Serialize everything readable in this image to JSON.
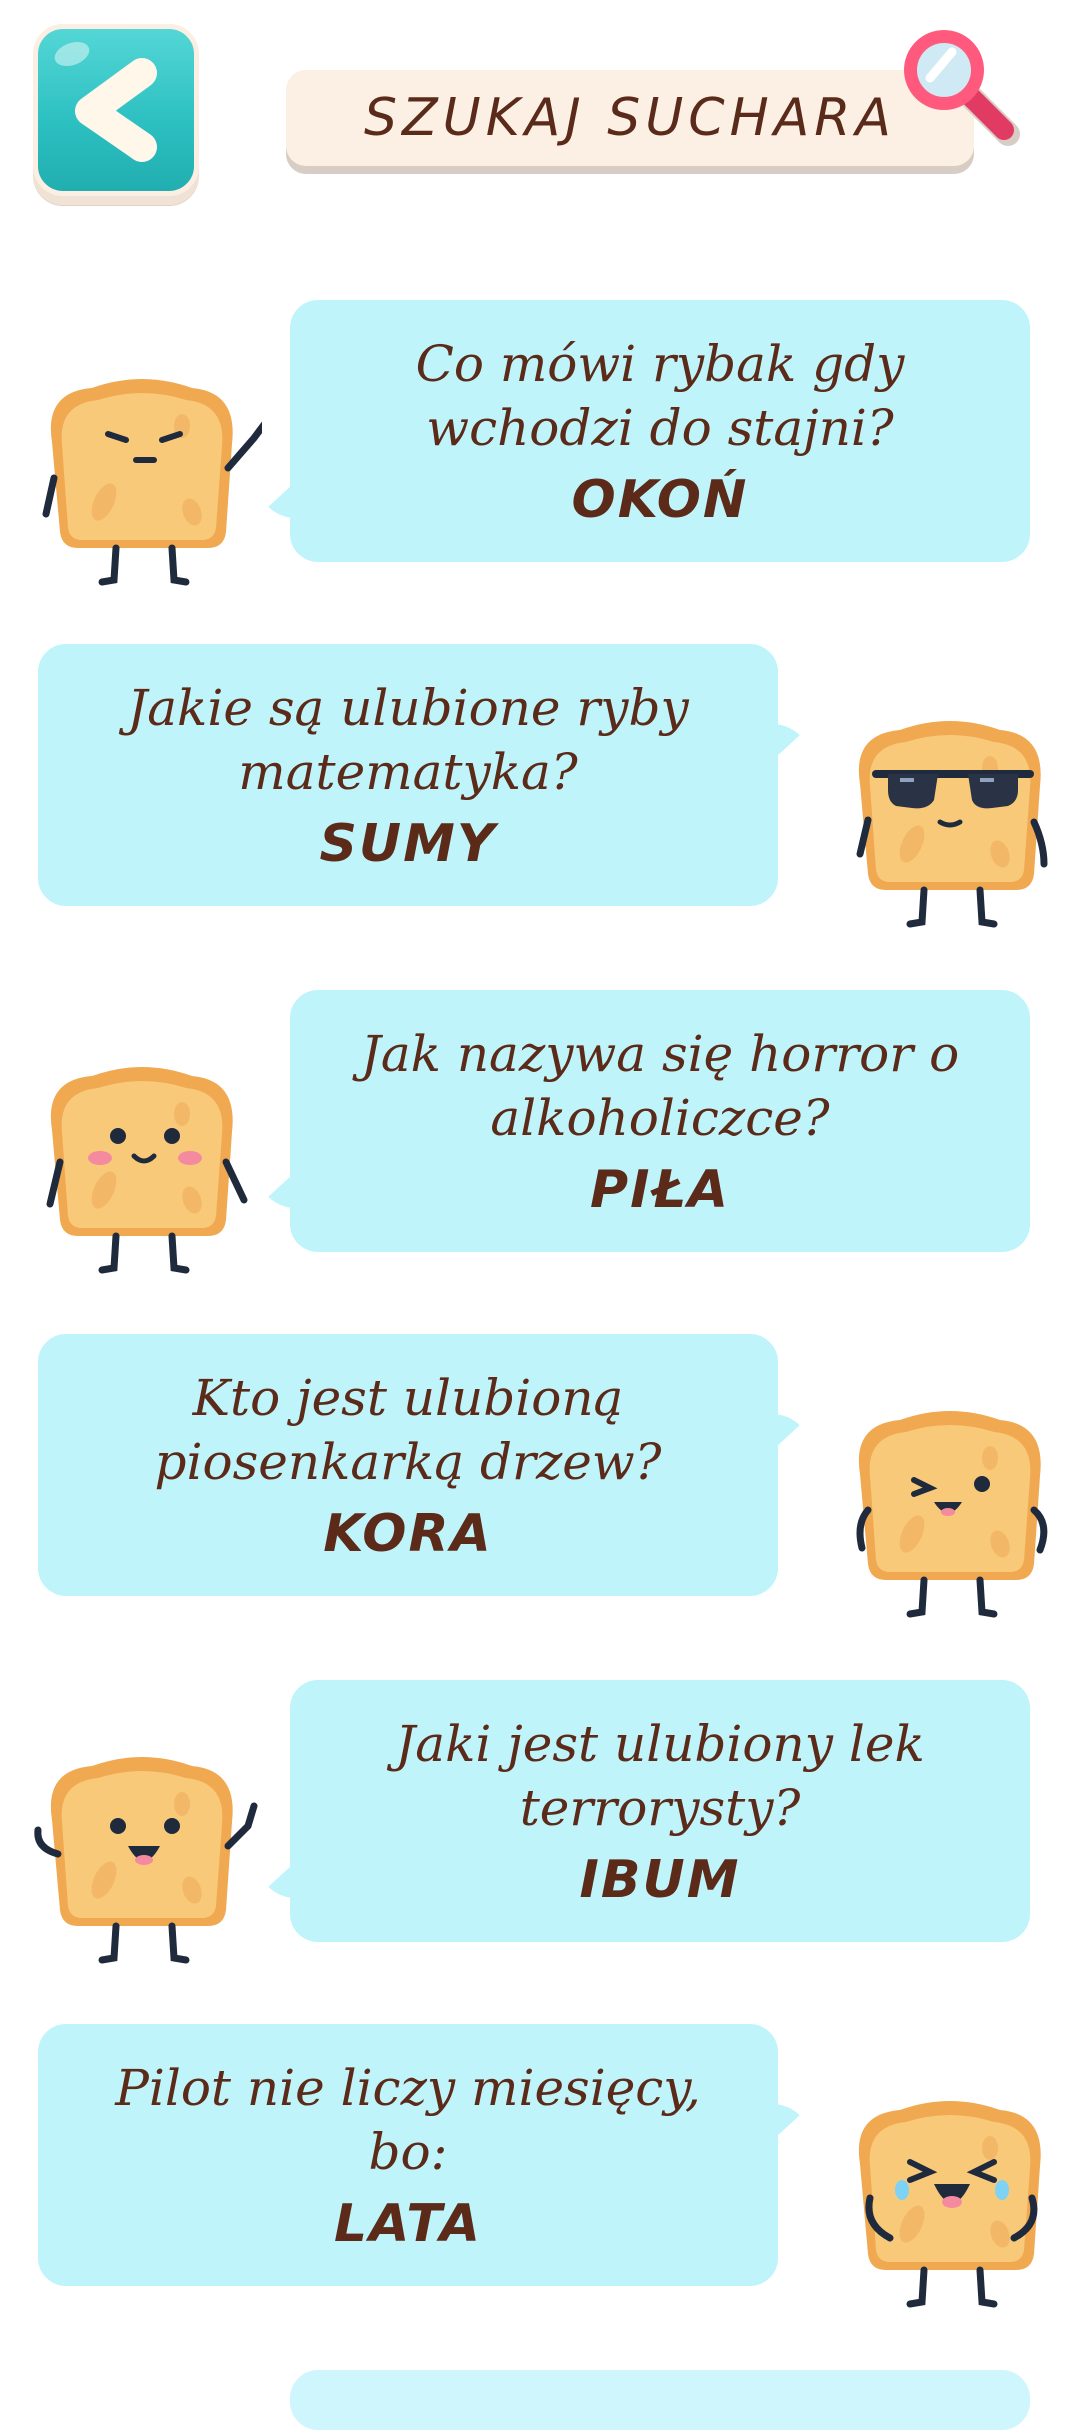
{
  "header": {
    "back_icon": "chevron-left-icon",
    "title": "SZUKAJ SUCHARA",
    "search_icon": "magnifier-icon"
  },
  "colors": {
    "bubble": "#bff4fb",
    "text": "#5b2a18",
    "back_button": "#2bbfc0",
    "pill": "#fcefe4"
  },
  "jokes": [
    {
      "question": "Co mówi rybak gdy wchodzi do stajni?",
      "answer": "OKOŃ",
      "mascot": "toast-neutral-waving"
    },
    {
      "question": "Jakie są ulubione ryby matematyka?",
      "answer": "SUMY",
      "mascot": "toast-sunglasses"
    },
    {
      "question": "Jak nazywa się horror o alkoholiczce?",
      "answer": "PIŁA",
      "mascot": "toast-blushing-smile"
    },
    {
      "question": "Kto jest ulubioną piosenkarką drzew?",
      "answer": "KORA",
      "mascot": "toast-winking"
    },
    {
      "question": "Jaki jest ulubiony lek terrorysty?",
      "answer": "IBUM",
      "mascot": "toast-excited-waving"
    },
    {
      "question": "Pilot nie liczy miesięcy, bo:",
      "answer": "LATA",
      "mascot": "toast-laughing-tears"
    }
  ]
}
